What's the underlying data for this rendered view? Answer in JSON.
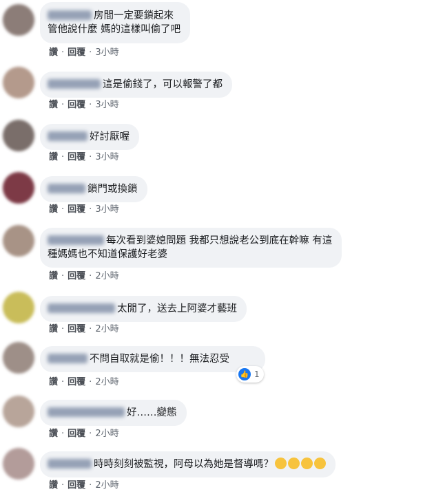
{
  "comments": [
    {
      "lines": [
        "房間一定要鎖起來",
        "管他說什麼 媽的這樣叫偷了吧"
      ],
      "like_label": "讚",
      "reply_label": "回覆",
      "time": "3小時",
      "avatar_color": "#8c7d78"
    },
    {
      "lines": [
        "這是偷錢了，可以報警了都"
      ],
      "like_label": "讚",
      "reply_label": "回覆",
      "time": "3小時",
      "avatar_color": "#b49a8c"
    },
    {
      "lines": [
        "好討厭喔"
      ],
      "like_label": "讚",
      "reply_label": "回覆",
      "time": "3小時",
      "avatar_color": "#7a6e6a"
    },
    {
      "lines": [
        "鎖門或換鎖"
      ],
      "like_label": "讚",
      "reply_label": "回覆",
      "time": "3小時",
      "avatar_color": "#7d3a46"
    },
    {
      "lines": [
        "每次看到婆媳問題 我都只想說老公到底在幹嘛 有這",
        "種媽媽也不知道保護好老婆"
      ],
      "like_label": "讚",
      "reply_label": "回覆",
      "time": "2小時",
      "avatar_color": "#a89386"
    },
    {
      "lines": [
        "太閒了，送去上阿婆才藝班"
      ],
      "like_label": "讚",
      "reply_label": "回覆",
      "time": "2小時",
      "avatar_color": "#c9bd5a"
    },
    {
      "lines": [
        "不問自取就是偷！！！無法忍受"
      ],
      "like_label": "讚",
      "reply_label": "回覆",
      "time": "2小時",
      "avatar_color": "#9e8f88",
      "reaction_count": "1"
    },
    {
      "lines": [
        "好……變態"
      ],
      "like_label": "讚",
      "reply_label": "回覆",
      "time": "2小時",
      "avatar_color": "#b8a59a"
    },
    {
      "lines": [
        "時時刻刻被監視，阿母以為她是督導嗎？"
      ],
      "like_label": "讚",
      "reply_label": "回覆",
      "time": "2小時",
      "avatar_color": "#b39c9a",
      "emoji_count": 4
    }
  ]
}
